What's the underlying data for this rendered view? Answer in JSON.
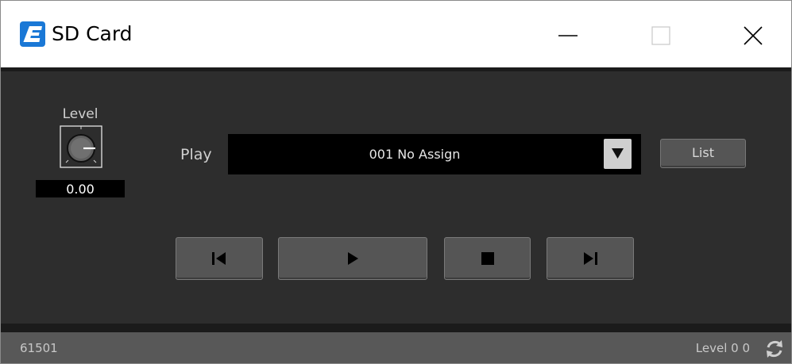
{
  "window": {
    "title": "SD Card",
    "icon": "app-e-icon",
    "accent": "#1a78d6"
  },
  "controls": {
    "minimize_icon": "minimize-icon",
    "maximize_icon": "maximize-icon",
    "close_icon": "close-icon"
  },
  "level": {
    "label": "Level",
    "value": "0.00"
  },
  "play": {
    "label": "Play",
    "selected": "001 No Assign",
    "list_button": "List"
  },
  "transport": [
    "previous-icon",
    "play-icon",
    "stop-icon",
    "next-icon"
  ],
  "status": {
    "id": "61501",
    "level_text": "Level 0 0",
    "refresh_icon": "refresh-icon"
  }
}
